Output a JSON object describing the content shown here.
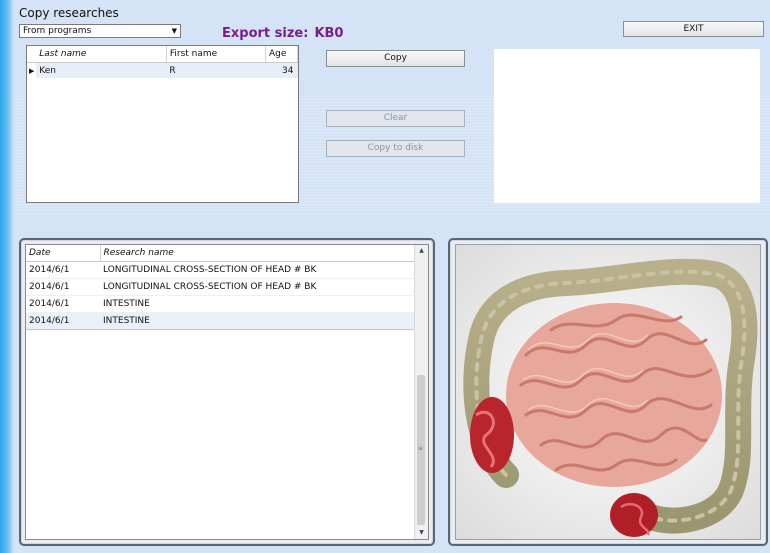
{
  "window": {
    "title": "Copy researches"
  },
  "source_select": {
    "value": "From programs"
  },
  "export": {
    "label": "Export size:",
    "value": "KB0"
  },
  "buttons": {
    "exit": "EXIT",
    "copy": "Copy",
    "clear": "Clear",
    "copy_to_disk": "Copy to disk"
  },
  "patients": {
    "columns": [
      "Last name",
      "First name",
      "Age"
    ],
    "rows": [
      {
        "last": "Ken",
        "first": "R",
        "age": "34"
      }
    ]
  },
  "researches": {
    "columns": [
      "Date",
      "Research name"
    ],
    "rows": [
      {
        "date": "2014/6/1",
        "name": "LONGITUDINAL CROSS-SECTION OF HEAD # BK"
      },
      {
        "date": "2014/6/1",
        "name": "LONGITUDINAL CROSS-SECTION OF HEAD # BK"
      },
      {
        "date": "2014/6/1",
        "name": "INTESTINE"
      },
      {
        "date": "2014/6/1",
        "name": "INTESTINE"
      }
    ],
    "selected_row": 4
  },
  "image": {
    "subject": "intestine-anatomy-illustration"
  },
  "colors": {
    "accent_purple": "#7a1e8c",
    "background": "#d4e3f5",
    "left_edge_blue": "#2aa6e6"
  }
}
